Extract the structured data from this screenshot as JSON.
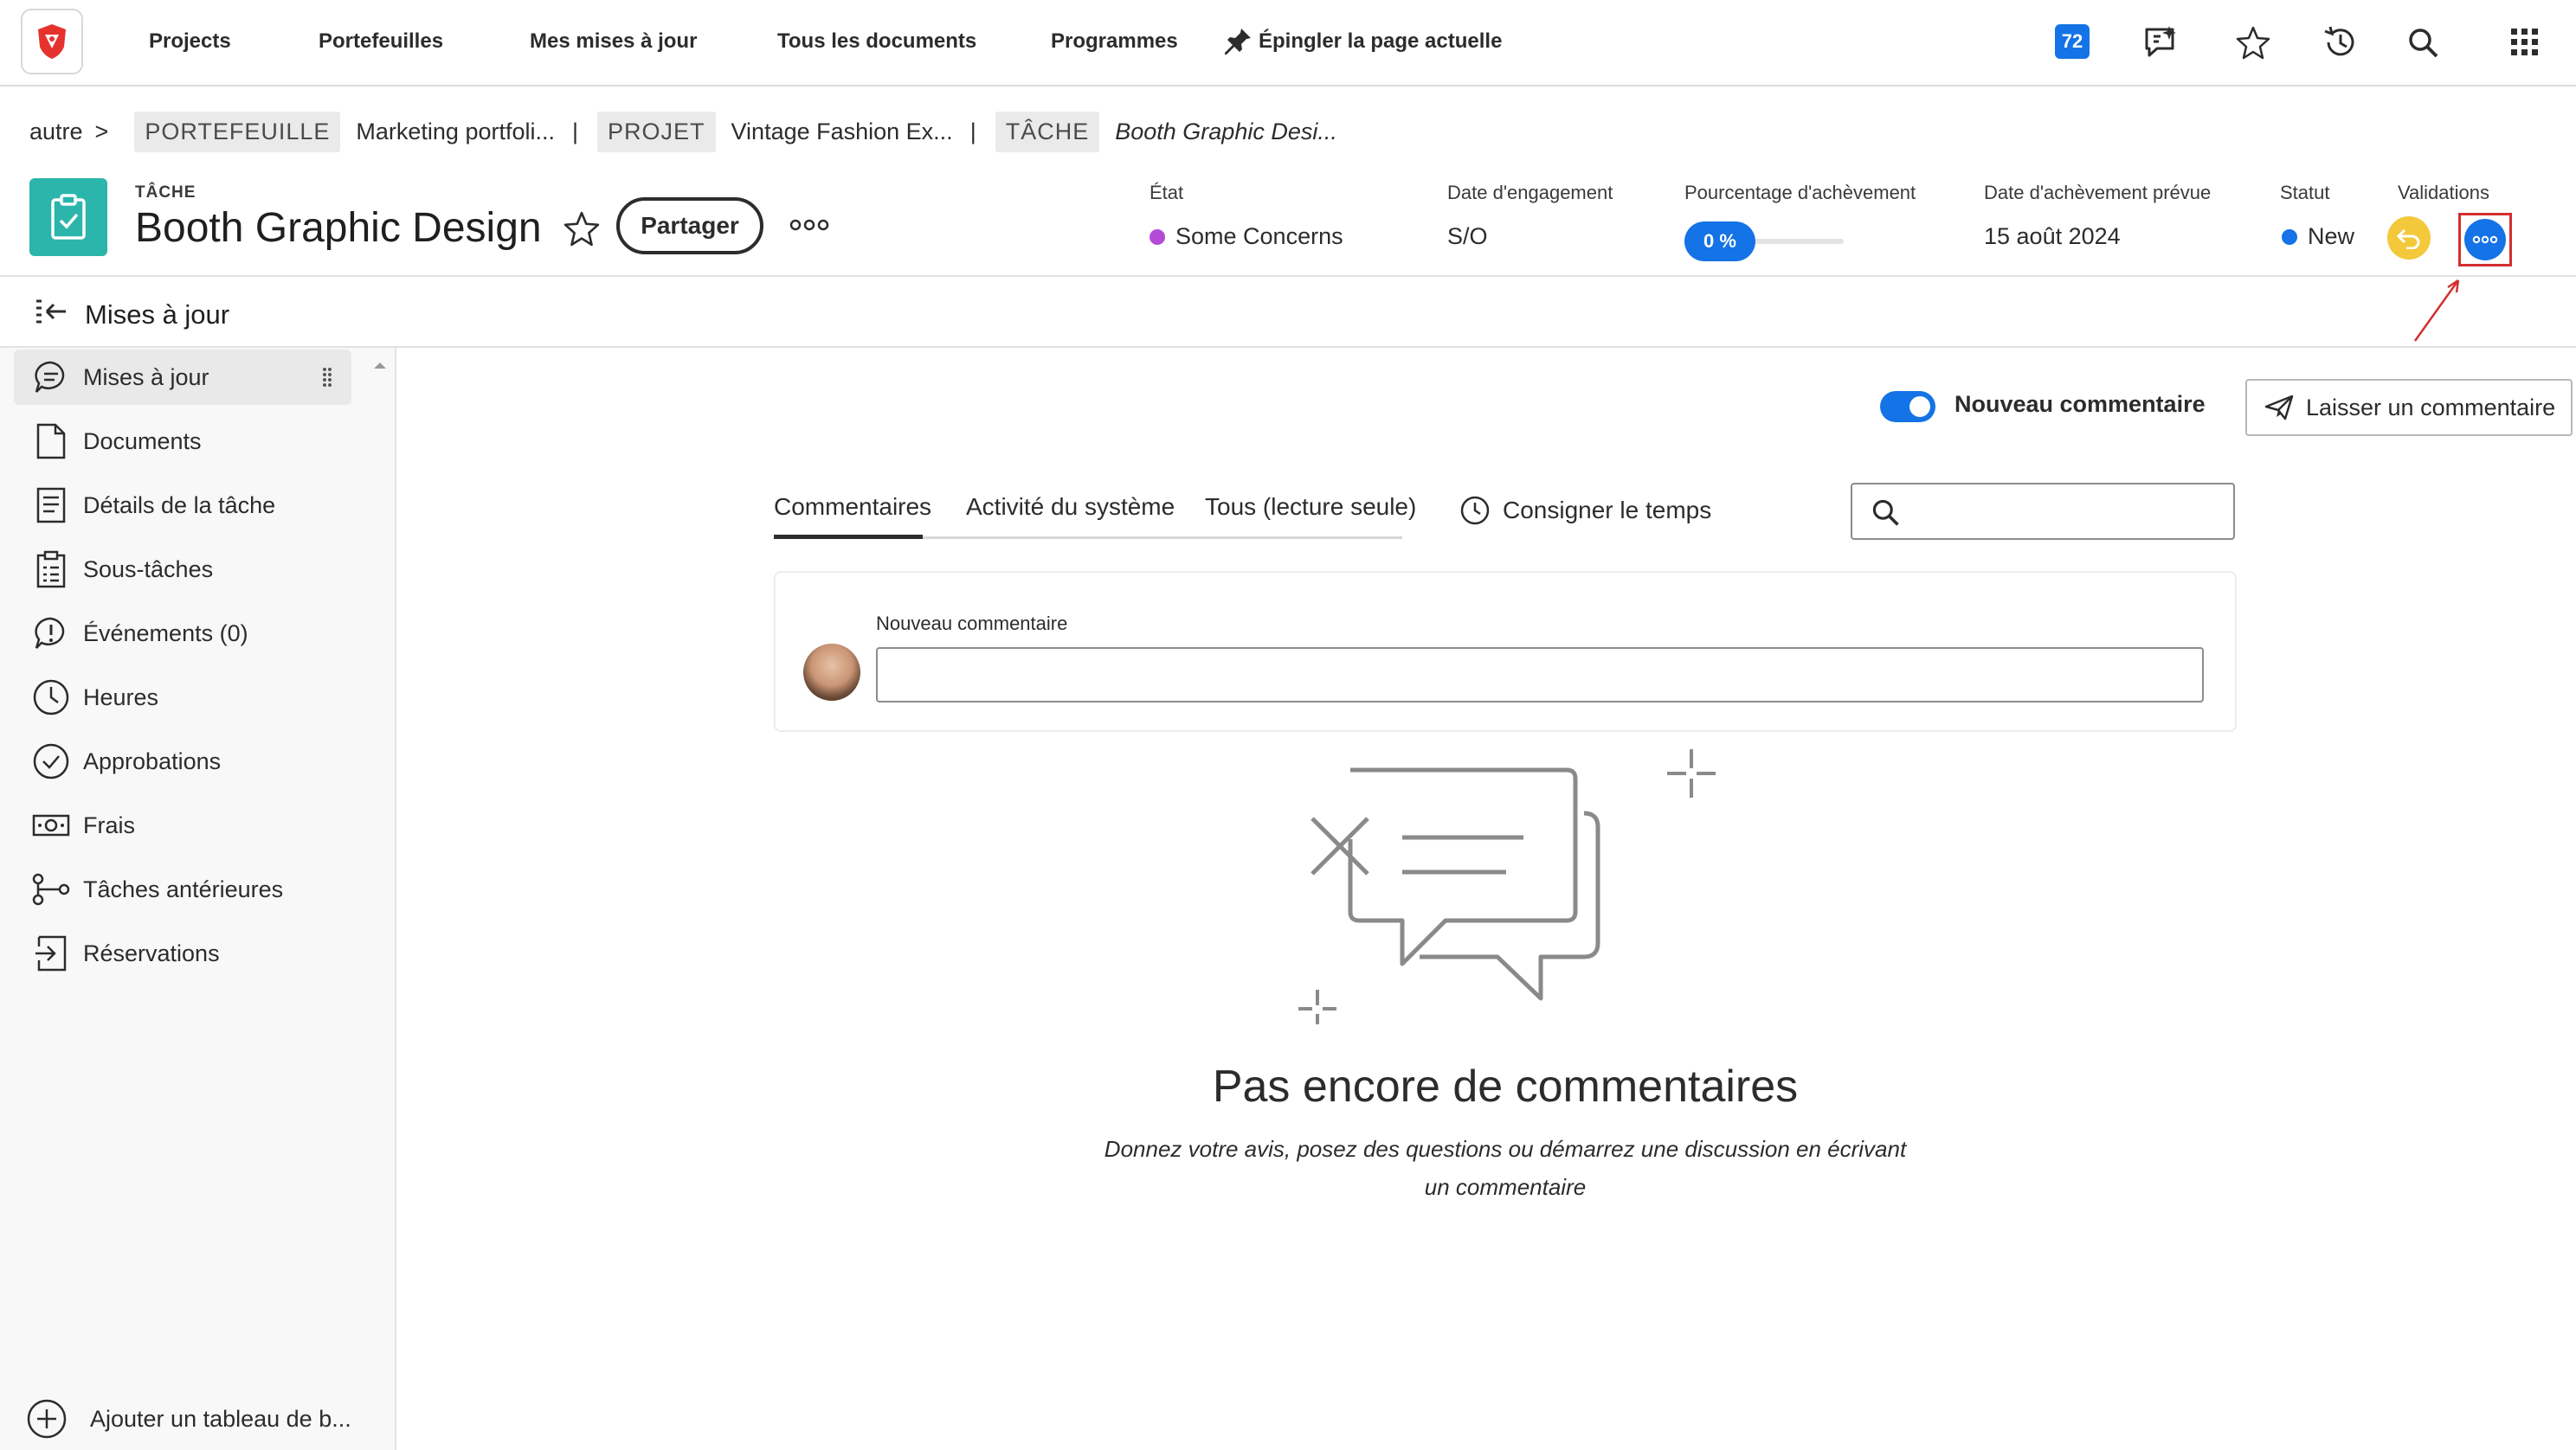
{
  "topnav": {
    "links": [
      "Projects",
      "Portefeuilles",
      "Mes mises à jour",
      "Tous les documents",
      "Programmes"
    ],
    "pin_label": "Épingler la page actuelle",
    "notification_count": "72",
    "icons": [
      "logo-icon",
      "pin-icon",
      "whats-new-icon",
      "star-icon",
      "history-icon",
      "search-icon",
      "apps-grid-icon"
    ]
  },
  "breadcrumb": {
    "root": "autre",
    "root_sep": ">",
    "portfolio_tag": "PORTEFEUILLE",
    "portfolio_name": "Marketing portfoli...",
    "project_tag": "PROJET",
    "project_name": "Vintage Fashion Ex...",
    "task_tag": "TÂCHE",
    "task_name": "Booth Graphic Desi...",
    "separator": "|"
  },
  "header": {
    "type_label": "TÂCHE",
    "title": "Booth Graphic Design",
    "share_label": "Partager",
    "fields": {
      "etat_label": "État",
      "etat_value": "Some Concerns",
      "engagement_label": "Date d'engagement",
      "engagement_value": "S/O",
      "progress_label": "Pourcentage d'achèvement",
      "progress_value": "0 %",
      "progress_fraction": 0,
      "planned_label": "Date d'achèvement prévue",
      "planned_value": "15 août 2024",
      "status_label": "Statut",
      "status_value": "New",
      "validations_label": "Validations"
    },
    "colors": {
      "etat_dot": "#b44bd6",
      "status_dot": "#1473e6",
      "accent": "#1473e6",
      "task_icon_bg": "#2bb5ab",
      "undo_approval": "#f4c83b",
      "annotation": "#d32f2f"
    }
  },
  "section": {
    "title": "Mises à jour"
  },
  "leftnav": {
    "items": [
      {
        "label": "Mises à jour",
        "icon": "chat-bubble-icon"
      },
      {
        "label": "Documents",
        "icon": "document-icon"
      },
      {
        "label": "Détails de la tâche",
        "icon": "details-icon"
      },
      {
        "label": "Sous-tâches",
        "icon": "clipboard-icon"
      },
      {
        "label": "Événements (0)",
        "icon": "alert-bubble-icon"
      },
      {
        "label": "Heures",
        "icon": "clock-icon"
      },
      {
        "label": "Approbations",
        "icon": "check-circle-icon"
      },
      {
        "label": "Frais",
        "icon": "money-icon"
      },
      {
        "label": "Tâches antérieures",
        "icon": "predecessor-icon"
      },
      {
        "label": "Réservations",
        "icon": "booking-icon"
      }
    ],
    "add_board_label": "Ajouter un tableau de b..."
  },
  "main": {
    "toggle_label": "Nouveau commentaire",
    "leave_comment_label": "Laisser un commentaire",
    "tabs": [
      "Commentaires",
      "Activité du système",
      "Tous (lecture seule)"
    ],
    "log_time_label": "Consigner le temps",
    "search_placeholder": "",
    "comment_box_label": "Nouveau commentaire",
    "comment_placeholder": "",
    "empty_title": "Pas encore de commentaires",
    "empty_desc": "Donnez votre avis, posez des questions ou démarrez une discussion en écrivant un commentaire"
  }
}
